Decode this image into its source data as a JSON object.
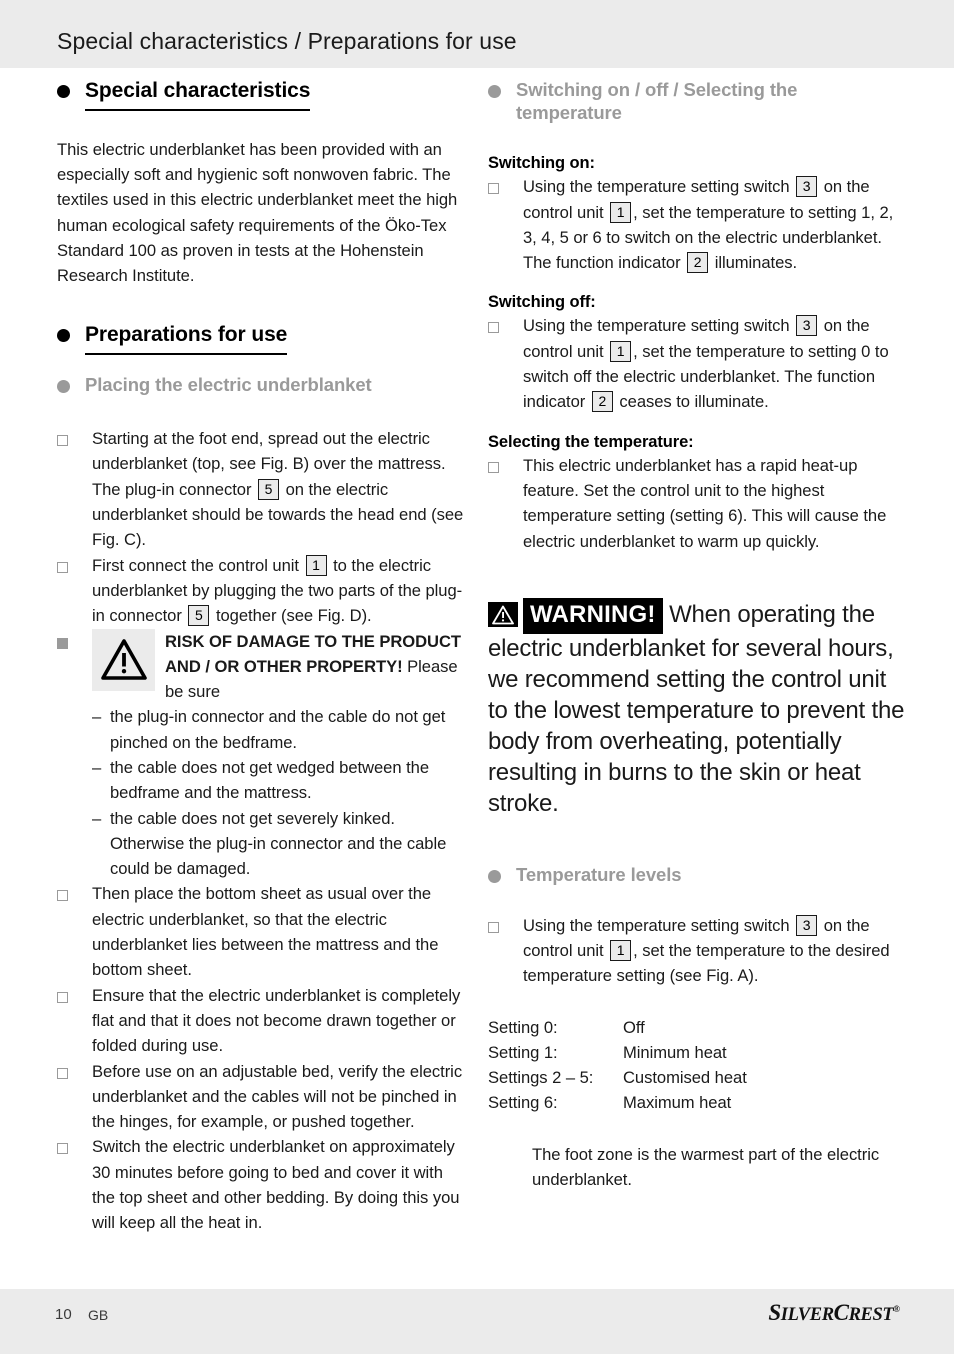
{
  "header": {
    "running_title": "Special characteristics / Preparations for use"
  },
  "left_column": {
    "heading_special": "Special characteristics",
    "special_paragraph": "This electric underblanket has been provided with an especially soft and hygienic soft nonwoven fabric. The textiles used in this electric underblanket meet the high human ecological safety requirements of the Öko-Tex Standard 100 as proven in tests at the Hohenstein Research Institute.",
    "heading_preparations": "Preparations for use",
    "subheading_placing": "Placing the electric underblanket",
    "item_spread_1": "Starting at the foot end, spread out the electric underblanket (top, see Fig. B) over the mattress. The plug-in connector",
    "item_spread_ref": "5",
    "item_spread_2": "on the electric underblanket should be towards the head end (see Fig. C).",
    "item_connect_1": "First connect the control unit",
    "item_connect_ref1": "1",
    "item_connect_2": "to the electric underblanket by plugging the two parts of the plug-in connector",
    "item_connect_ref2": "5",
    "item_connect_3": "together (see Fig. D).",
    "risk_title": "RISK OF DAMAGE TO THE PRODUCT AND / OR OTHER PROPERTY!",
    "risk_intro": "Please be sure",
    "risk_dashes": [
      "the plug-in connector and the cable do not get pinched on the bedframe.",
      "the cable does not get wedged between the bedframe and the mattress.",
      "the cable does not get severely kinked. Otherwise the plug-in connector and the cable could be damaged."
    ],
    "item_bottomsheet": "Then place the bottom sheet as usual over the electric underblanket, so that the electric underblanket lies between the mattress and the bottom sheet.",
    "item_flat": "Ensure that the electric underblanket is completely flat and that it does not become drawn together or folded during use.",
    "item_adjustable": "Before use on an adjustable bed, verify the electric underblanket and the cables will not be pinched in the hinges, for example, or pushed together.",
    "item_switch30": "Switch the electric underblanket on approximately 30 minutes before going to bed and cover it with the top sheet and other bedding. By doing this you will keep all the heat in."
  },
  "right_column": {
    "subheading_switching": "Switching on / off / Selecting the temperature",
    "switching_on_label": "Switching on:",
    "on_1": "Using the temperature setting switch",
    "on_ref_switch": "3",
    "on_2": "on the control unit",
    "on_ref_unit": "1",
    "on_3": ", set the temperature to setting 1, 2, 3, 4, 5 or 6 to switch on the electric underblanket. The function indicator",
    "on_ref_indicator": "2",
    "on_4": "illuminates.",
    "switching_off_label": "Switching off:",
    "off_1": "Using the temperature setting switch",
    "off_ref_switch": "3",
    "off_2": "on the control unit",
    "off_ref_unit": "1",
    "off_3": ", set the temperature to setting 0 to switch off the electric underblanket. The function indicator",
    "off_ref_indicator": "2",
    "off_4": "ceases to illuminate.",
    "selecting_label": "Selecting the temperature:",
    "selecting_text": "This electric underblanket has a rapid heat-up feature. Set the control unit to the highest temperature setting (setting 6). This will cause the electric underblanket to warm up quickly.",
    "warning_word": "WARNING!",
    "warning_text": "When operating the electric underblanket for several hours, we recommend setting the control unit to the lowest temperature to prevent the body from overheating, potentially resulting in burns to the skin or heat stroke.",
    "subheading_levels": "Temperature levels",
    "levels_1": "Using the temperature setting switch",
    "levels_ref_switch": "3",
    "levels_2": "on the control unit",
    "levels_ref_unit": "1",
    "levels_3": ", set the temperature to the desired temperature setting (see Fig. A).",
    "settings_table": [
      {
        "label": "Setting 0:",
        "value": "Off"
      },
      {
        "label": "Setting 1:",
        "value": "Minimum heat"
      },
      {
        "label": "Settings 2 – 5:",
        "value": "Customised heat"
      },
      {
        "label": "Setting 6:",
        "value": "Maximum heat"
      }
    ],
    "foot_zone_note": "The foot zone is the warmest part of the electric underblanket."
  },
  "footer": {
    "page_number": "10",
    "language_code": "GB",
    "brand_part1_big": "S",
    "brand_part1_small": "ILVER",
    "brand_part2_big": "C",
    "brand_part2_small": "REST",
    "brand_registered": "®"
  },
  "colors": {
    "page_background": "#ebebeb",
    "sheet_background": "#ffffff",
    "text": "#1a1a1a",
    "gray_heading": "#9a9a9a",
    "warning_badge_bg": "#000000"
  }
}
